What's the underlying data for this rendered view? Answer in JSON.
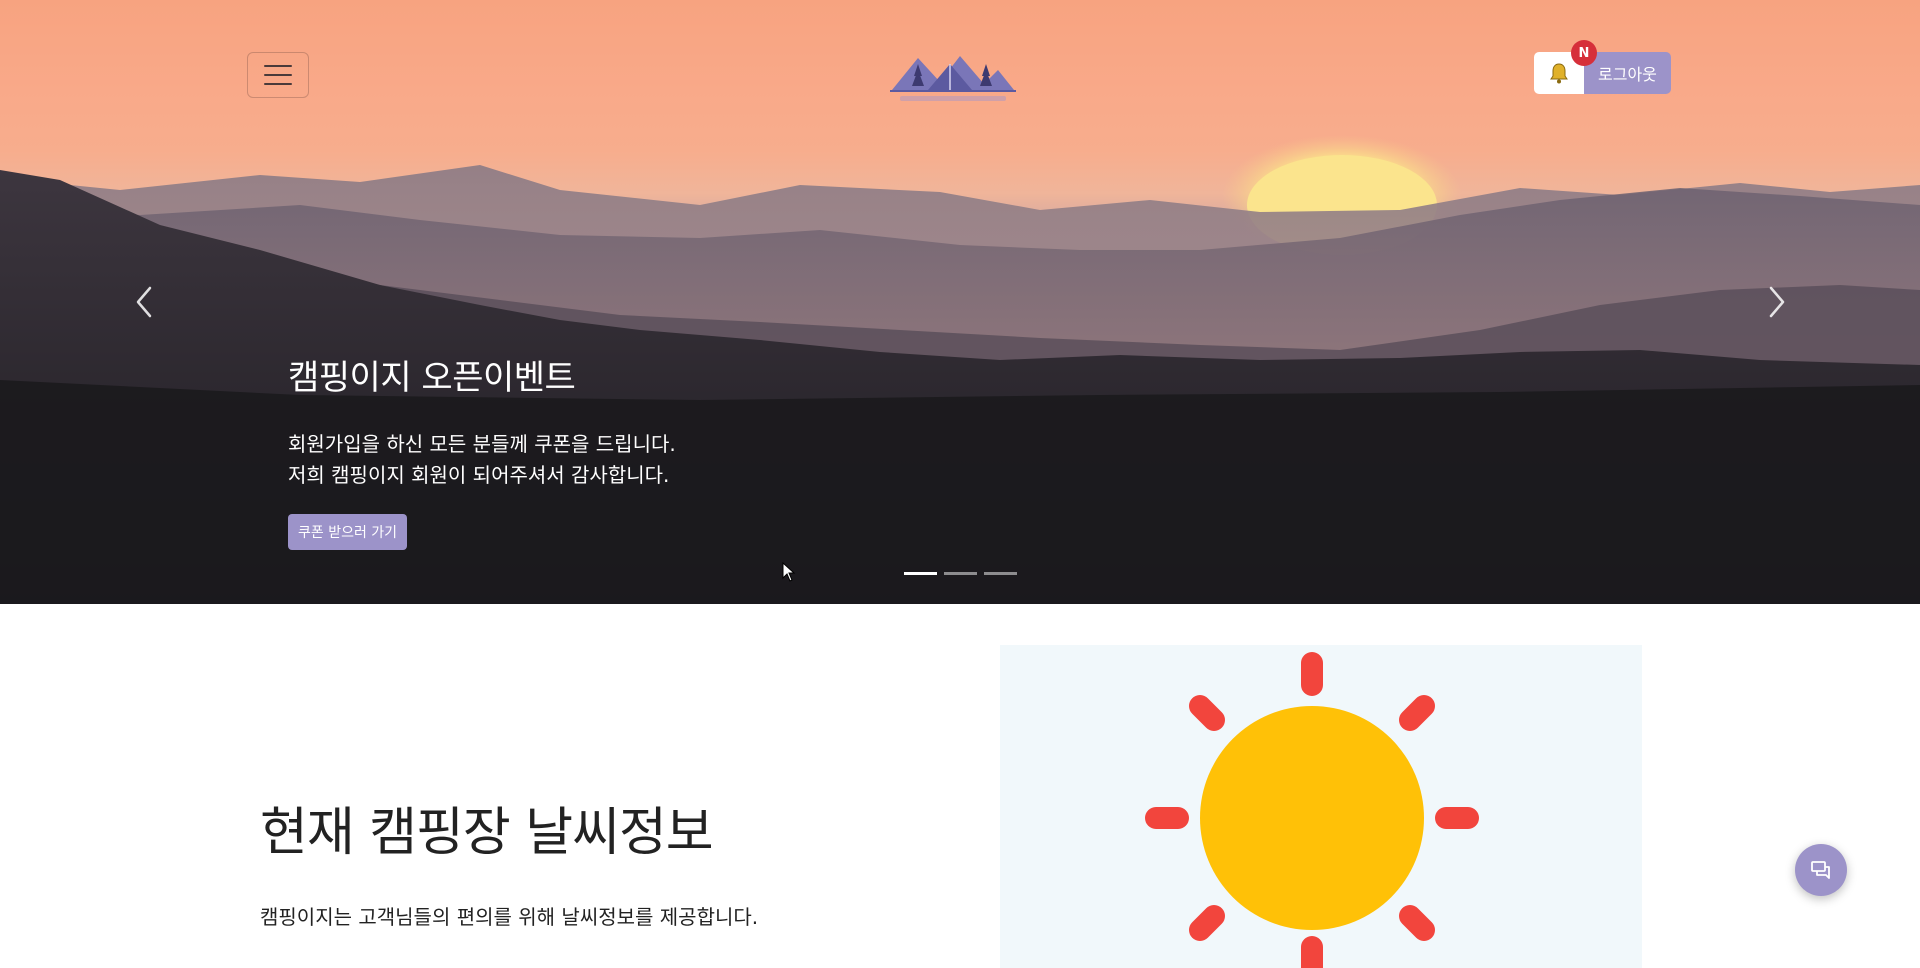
{
  "header": {
    "menu_icon": "hamburger-icon",
    "logo_icon": "mountain-tent-logo",
    "bell_icon": "bell-icon",
    "notification_badge": "N",
    "logout_label": "로그아웃"
  },
  "carousel": {
    "slide_title": "캠핑이지 오픈이벤트",
    "line1": "회원가입을 하신 모든 분들께 쿠폰을 드립니다.",
    "line2": "저희 캠핑이지 회원이 되어주셔서 감사합니다.",
    "cta_label": "쿠폰 받으러 가기",
    "prev_icon": "chevron-left-icon",
    "next_icon": "chevron-right-icon",
    "slide_count": 3,
    "active_slide": 1
  },
  "weather": {
    "title": "현재 캠핑장 날씨정보",
    "description": "캠핑이지는 고객님들의 편의를 위해 날씨정보를 제공합니다.",
    "condition_icon": "sun-icon"
  },
  "chat": {
    "icon": "chat-icon"
  },
  "colors": {
    "accent": "#9c93c9",
    "badge": "#d62f3a",
    "sun": "#ffc107",
    "sun_rays": "#f2453d"
  }
}
